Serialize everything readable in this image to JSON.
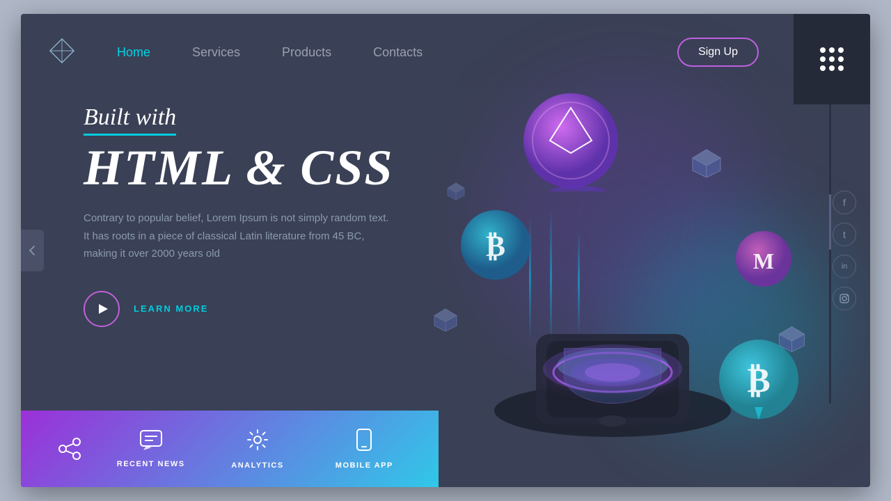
{
  "nav": {
    "logo_label": "logo-diamond",
    "links": [
      {
        "label": "Home",
        "active": true
      },
      {
        "label": "Services",
        "active": false
      },
      {
        "label": "Products",
        "active": false
      },
      {
        "label": "Contacts",
        "active": false
      }
    ],
    "signup_label": "Sign Up",
    "menu_icon": "···"
  },
  "hero": {
    "built_with": "Built with",
    "main_title": "HTML & CSS",
    "subtitle": "Contrary to popular belief, Lorem Ipsum is not simply random text. It has roots in a piece of classical Latin literature from 45 BC, making it over 2000 years old",
    "learn_more": "LEARN MORE"
  },
  "bottom_bar": {
    "items": [
      {
        "icon": "💬",
        "label": "RECENT NEWS"
      },
      {
        "icon": "⚙",
        "label": "ANALYTICS"
      },
      {
        "icon": "📱",
        "label": "MOBILE APP"
      }
    ]
  },
  "social": {
    "icons": [
      {
        "name": "facebook-icon",
        "symbol": "f"
      },
      {
        "name": "twitter-icon",
        "symbol": "t"
      },
      {
        "name": "linkedin-icon",
        "symbol": "in"
      },
      {
        "name": "instagram-icon",
        "symbol": "◻"
      }
    ]
  },
  "colors": {
    "accent_cyan": "#00ccdd",
    "accent_purple": "#c060e0",
    "bg_dark": "#3a4055",
    "bg_darker": "#252a38"
  }
}
